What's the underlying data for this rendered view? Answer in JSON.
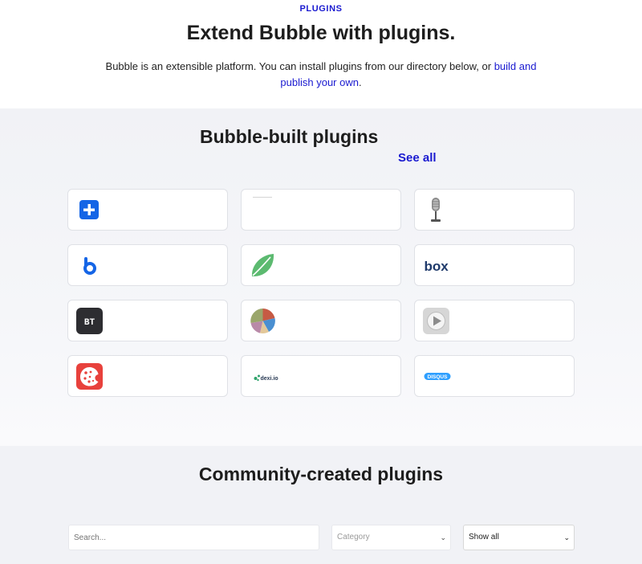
{
  "hero": {
    "eyebrow": "PLUGINS",
    "title": "Extend Bubble with plugins.",
    "desc_text": "Bubble is an extensible platform. You can install plugins from our directory below, or ",
    "desc_link": "build and publish your own",
    "desc_end": "."
  },
  "builtin": {
    "title": "Bubble-built plugins",
    "see_all": "See all",
    "logos": {
      "box": "box",
      "bt": "BT",
      "dexi": "dexi.io",
      "disqus": "DISQUS"
    }
  },
  "community": {
    "title": "Community-created plugins",
    "search_placeholder": "Search...",
    "category_placeholder": "Category",
    "show_value": "Show all"
  },
  "colors": {
    "accent": "#1a1ad0",
    "section_bg": "#f1f2f6"
  }
}
